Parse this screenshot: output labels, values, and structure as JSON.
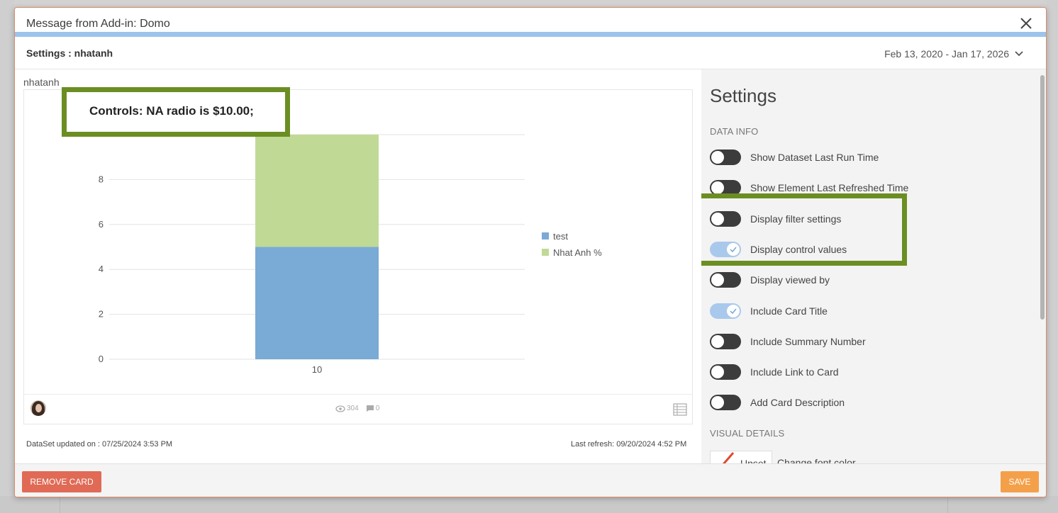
{
  "dialog": {
    "title": "Message from Add-in: Domo",
    "settings_title": "Settings : nhatanh",
    "date_range": "Feb 13, 2020 - Jan 17, 2026"
  },
  "card": {
    "name": "nhatanh",
    "controls_text": "Controls: NA radio is $10.00;",
    "views": "304",
    "comments": "0",
    "dataset_updated": "DataSet updated on : 07/25/2024 3:53 PM",
    "last_refresh": "Last refresh: 09/20/2024 4:52 PM"
  },
  "chart_data": {
    "type": "bar",
    "stacked": true,
    "categories": [
      "10"
    ],
    "series": [
      {
        "name": "test",
        "values": [
          5
        ],
        "color": "#7aaad6"
      },
      {
        "name": "Nhat Anh %",
        "values": [
          5
        ],
        "color": "#c0da96"
      }
    ],
    "yticks": [
      0,
      2,
      4,
      6,
      8
    ],
    "ylim": [
      0,
      10
    ],
    "grid": true,
    "legend_position": "right"
  },
  "settings_panel": {
    "heading": "Settings",
    "data_info_label": "DATA INFO",
    "toggles": [
      {
        "label": "Show Dataset Last Run Time",
        "on": false
      },
      {
        "label": "Show Element Last Refreshed Time",
        "on": false
      },
      {
        "label": "Display filter settings",
        "on": false
      },
      {
        "label": "Display control values",
        "on": true
      },
      {
        "label": "Display viewed by",
        "on": false
      },
      {
        "label": "Include Card Title",
        "on": true
      },
      {
        "label": "Include Summary Number",
        "on": false
      },
      {
        "label": "Include Link to Card",
        "on": false
      },
      {
        "label": "Add Card Description",
        "on": false
      }
    ],
    "visual_details_label": "VISUAL DETAILS",
    "unset_label": "Unset",
    "font_color_label": "Change font color"
  },
  "footer": {
    "remove_label": "REMOVE CARD",
    "save_label": "SAVE"
  }
}
